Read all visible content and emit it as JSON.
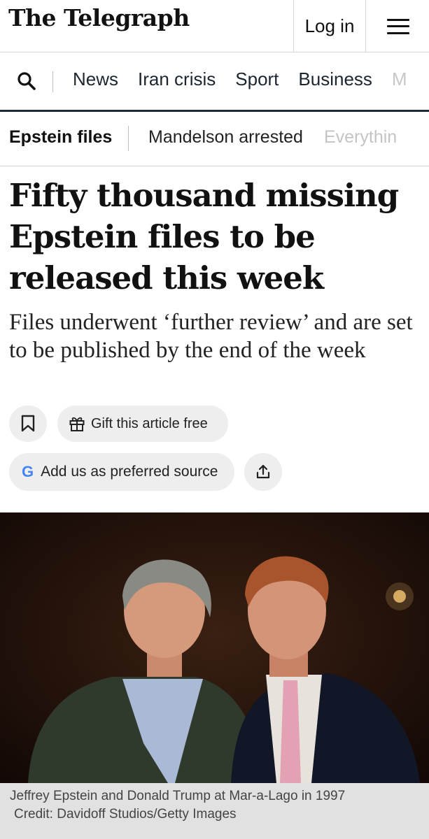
{
  "header": {
    "logo": "The Telegraph",
    "login_label": "Log in",
    "menu_icon": "hamburger-menu-icon"
  },
  "nav": {
    "search_icon": "search-icon",
    "items": [
      "News",
      "Iran crisis",
      "Sport",
      "Business",
      "M"
    ]
  },
  "subnav": {
    "items": [
      "Epstein files",
      "Mandelson arrested",
      "Everythin"
    ]
  },
  "article": {
    "headline": "Fifty thousand missing Epstein files to be released this week",
    "standfirst": "Files underwent ‘further review’ and are set to be published by the end of the week",
    "gift_label": "Gift this article free",
    "preferred_source_label": "Add us as preferred source",
    "google_mark": "G",
    "bookmark_icon": "bookmark-icon",
    "gift_icon": "gift-icon",
    "share_icon": "share-icon",
    "caption": "Jeffrey Epstein and Donald Trump at Mar-a-Lago in 1997",
    "credit": "Credit: Davidoff Studios/Getty Images"
  },
  "colors": {
    "nav_underline": "#1d2b36",
    "button_bg": "#eeeeee",
    "caption_bg": "#e1e1e1",
    "photo_bg": "#1a0c07"
  }
}
